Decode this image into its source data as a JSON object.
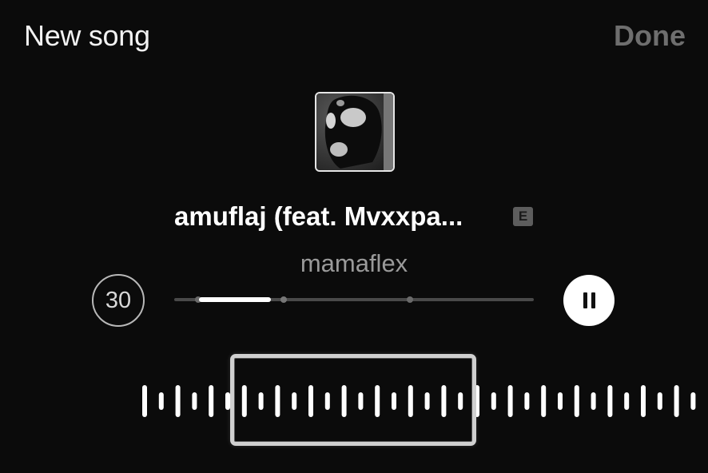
{
  "header": {
    "title": "New song",
    "done_label": "Done",
    "done_color": "#6e6e6e"
  },
  "track": {
    "title": "amuflaj (feat. Mvxxpa...",
    "explicit_badge": "E",
    "artist": "mamaflex"
  },
  "player": {
    "duration_label": "30",
    "state": "playing",
    "pause_icon": "pause-icon"
  },
  "colors": {
    "background": "#0b0b0b",
    "text_primary": "#ffffff",
    "text_secondary": "#9a9a9a",
    "accent_disabled": "#6e6e6e"
  }
}
